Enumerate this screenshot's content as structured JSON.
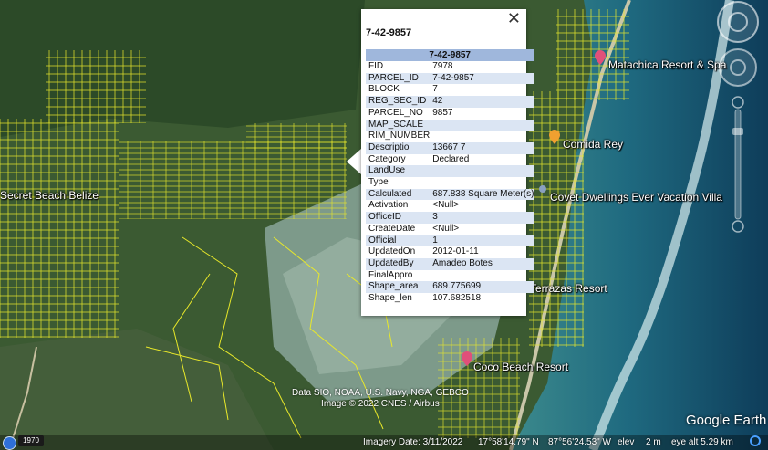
{
  "places": [
    {
      "name": "Matachica Resort & Spa",
      "pin_color": "#e0507a"
    },
    {
      "name": "Comida Rey",
      "pin_color": "#f0a030"
    },
    {
      "name": "Covet Dwellings Ever Vacation Villa",
      "pin_color": "#8aa0c0"
    },
    {
      "name": "Secret Beach Belize"
    },
    {
      "name": "Terrazas Resort"
    },
    {
      "name": "Coco Beach Resort",
      "pin_color": "#e0507a"
    }
  ],
  "popup": {
    "title": "7-42-9857",
    "header": "7-42-9857",
    "close_glyph": "✕",
    "rows": [
      {
        "key": "FID",
        "value": "7978"
      },
      {
        "key": "PARCEL_ID",
        "value": "7-42-9857"
      },
      {
        "key": "BLOCK",
        "value": "7"
      },
      {
        "key": "REG_SEC_ID",
        "value": "42"
      },
      {
        "key": "PARCEL_NO",
        "value": "9857"
      },
      {
        "key": "MAP_SCALE",
        "value": ""
      },
      {
        "key": "RIM_NUMBER",
        "value": ""
      },
      {
        "key": "Descriptio",
        "value": "13667 7"
      },
      {
        "key": "Category",
        "value": "Declared"
      },
      {
        "key": "LandUse",
        "value": ""
      },
      {
        "key": "Type",
        "value": ""
      },
      {
        "key": "Calculated",
        "value": "687.838 Square Meter(s)"
      },
      {
        "key": "Activation",
        "value": "<Null>"
      },
      {
        "key": "OfficeID",
        "value": "3"
      },
      {
        "key": "CreateDate",
        "value": "<Null>"
      },
      {
        "key": "Official",
        "value": "1"
      },
      {
        "key": "UpdatedOn",
        "value": "2012-01-11"
      },
      {
        "key": "UpdatedBy",
        "value": "Amadeo Botes"
      },
      {
        "key": "FinalAppro",
        "value": ""
      },
      {
        "key": "Shape_area",
        "value": "689.775699"
      },
      {
        "key": "Shape_len",
        "value": "107.682518"
      }
    ]
  },
  "credits": {
    "line1": "Data SIO, NOAA, U.S. Navy, NGA, GEBCO",
    "line2": "Image © 2022 CNES / Airbus"
  },
  "logo": "Google Earth",
  "status": {
    "year": "1970",
    "imagery_date": "Imagery Date: 3/11/2022",
    "lat": "17°58'14.79\" N",
    "lon": "87°56'24.53\" W",
    "elev_label": "elev",
    "elev_value": "2 m",
    "eye_alt": "eye alt  5.29 km"
  },
  "colors": {
    "parcel_lines": "#e8e82a",
    "land": "#3b5a32",
    "sea_shallow": "#3c8a8c",
    "sea_deep": "#0e3d5a",
    "popup_header": "#9fb7dc",
    "popup_alt_row": "#dbe5f3"
  }
}
